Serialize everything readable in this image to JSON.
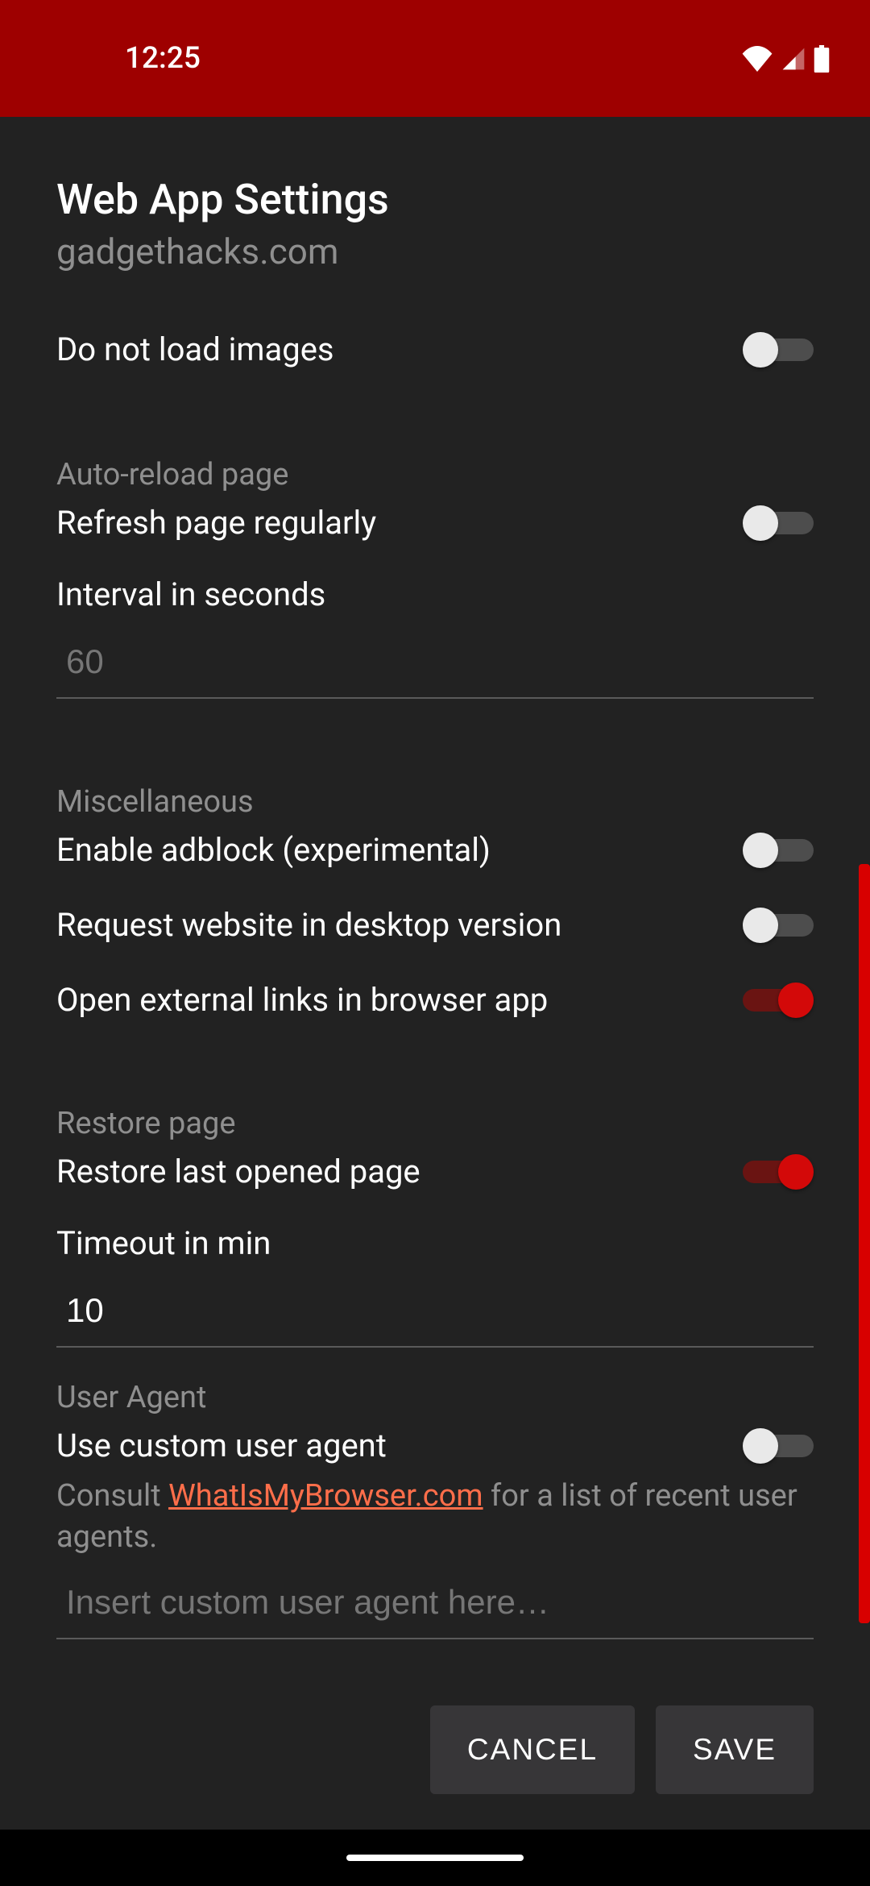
{
  "status": {
    "time": "12:25"
  },
  "header": {
    "title": "Web App Settings",
    "subtitle": "gadgethacks.com"
  },
  "settings": {
    "do_not_load_images": {
      "label": "Do not load images",
      "enabled": false
    },
    "auto_reload_heading": "Auto-reload page",
    "refresh_regularly": {
      "label": "Refresh page regularly",
      "enabled": false
    },
    "interval_label": "Interval in seconds",
    "interval_placeholder": "60",
    "misc_heading": "Miscellaneous",
    "adblock": {
      "label": "Enable adblock (experimental)",
      "enabled": false
    },
    "desktop_version": {
      "label": "Request website in desktop version",
      "enabled": false
    },
    "external_links": {
      "label": "Open external links in browser app",
      "enabled": true
    },
    "restore_heading": "Restore page",
    "restore_last": {
      "label": "Restore last opened page",
      "enabled": true
    },
    "timeout_label": "Timeout in min",
    "timeout_value": "10",
    "user_agent_heading": "User Agent",
    "custom_ua": {
      "label": "Use custom user agent",
      "enabled": false
    },
    "ua_hint_prefix": "Consult ",
    "ua_hint_link": "WhatIsMyBrowser.com",
    "ua_hint_suffix": " for a list of recent user agents.",
    "ua_placeholder": "Insert custom user agent here…"
  },
  "buttons": {
    "cancel": "CANCEL",
    "save": "SAVE"
  }
}
